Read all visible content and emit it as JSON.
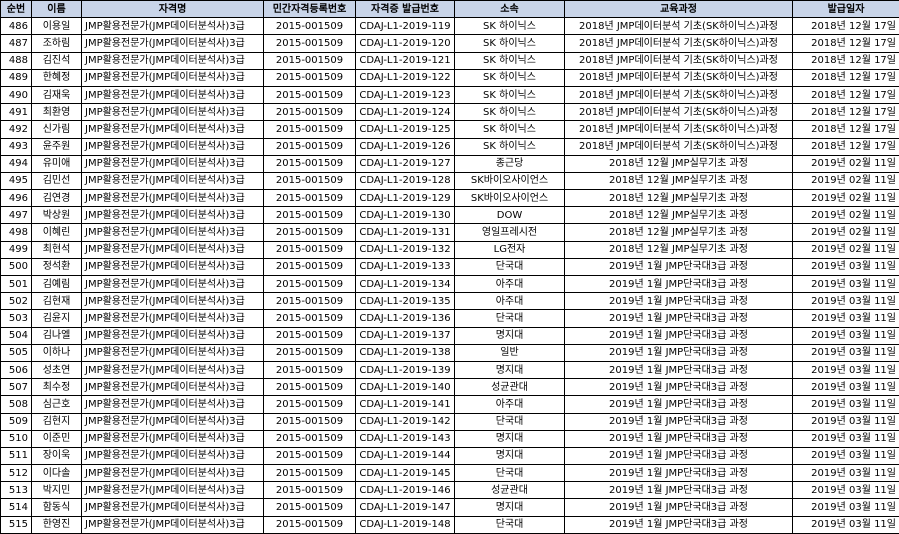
{
  "header": {
    "no": "순번",
    "name": "이름",
    "qual": "자격명",
    "reg": "민간자격등록번호",
    "cert": "자격증 발급번호",
    "org": "소속",
    "course": "교육과정",
    "date": "발급일자"
  },
  "rows": [
    {
      "no": "486",
      "name": "이용일",
      "qual": "JMP활용전문가(JMP데이터분석사)3급",
      "reg": "2015-001509",
      "cert": "CDAJ-L1-2019-119",
      "org": "SK 하이닉스",
      "course": "2018년 JMP데이터분석 기초(SK하이닉스)과정",
      "date": "2018년 12월 17일"
    },
    {
      "no": "487",
      "name": "조하림",
      "qual": "JMP활용전문가(JMP데이터분석사)3급",
      "reg": "2015-001509",
      "cert": "CDAJ-L1-2019-120",
      "org": "SK 하이닉스",
      "course": "2018년 JMP데이터분석 기초(SK하이닉스)과정",
      "date": "2018년 12월 17일"
    },
    {
      "no": "488",
      "name": "김진석",
      "qual": "JMP활용전문가(JMP데이터분석사)3급",
      "reg": "2015-001509",
      "cert": "CDAJ-L1-2019-121",
      "org": "SK 하이닉스",
      "course": "2018년 JMP데이터분석 기초(SK하이닉스)과정",
      "date": "2018년 12월 17일"
    },
    {
      "no": "489",
      "name": "한혜정",
      "qual": "JMP활용전문가(JMP데이터분석사)3급",
      "reg": "2015-001509",
      "cert": "CDAJ-L1-2019-122",
      "org": "SK 하이닉스",
      "course": "2018년 JMP데이터분석 기초(SK하이닉스)과정",
      "date": "2018년 12월 17일"
    },
    {
      "no": "490",
      "name": "김재욱",
      "qual": "JMP활용전문가(JMP데이터분석사)3급",
      "reg": "2015-001509",
      "cert": "CDAJ-L1-2019-123",
      "org": "SK 하이닉스",
      "course": "2018년 JMP데이터분석 기초(SK하이닉스)과정",
      "date": "2018년 12월 17일"
    },
    {
      "no": "491",
      "name": "최환영",
      "qual": "JMP활용전문가(JMP데이터분석사)3급",
      "reg": "2015-001509",
      "cert": "CDAJ-L1-2019-124",
      "org": "SK 하이닉스",
      "course": "2018년 JMP데이터분석 기초(SK하이닉스)과정",
      "date": "2018년 12월 17일"
    },
    {
      "no": "492",
      "name": "신가림",
      "qual": "JMP활용전문가(JMP데이터분석사)3급",
      "reg": "2015-001509",
      "cert": "CDAJ-L1-2019-125",
      "org": "SK 하이닉스",
      "course": "2018년 JMP데이터분석 기초(SK하이닉스)과정",
      "date": "2018년 12월 17일"
    },
    {
      "no": "493",
      "name": "윤주원",
      "qual": "JMP활용전문가(JMP데이터분석사)3급",
      "reg": "2015-001509",
      "cert": "CDAJ-L1-2019-126",
      "org": "SK 하이닉스",
      "course": "2018년 JMP데이터분석 기초(SK하이닉스)과정",
      "date": "2018년 12월 17일"
    },
    {
      "no": "494",
      "name": "유미애",
      "qual": "JMP활용전문가(JMP데이터분석사)3급",
      "reg": "2015-001509",
      "cert": "CDAJ-L1-2019-127",
      "org": "종근당",
      "course": "2018년 12월 JMP실무기초 과정",
      "date": "2019년 02월 11일"
    },
    {
      "no": "495",
      "name": "김민선",
      "qual": "JMP활용전문가(JMP데이터분석사)3급",
      "reg": "2015-001509",
      "cert": "CDAJ-L1-2019-128",
      "org": "SK바이오사이언스",
      "course": "2018년 12월 JMP실무기초 과정",
      "date": "2019년 02월 11일"
    },
    {
      "no": "496",
      "name": "김연경",
      "qual": "JMP활용전문가(JMP데이터분석사)3급",
      "reg": "2015-001509",
      "cert": "CDAJ-L1-2019-129",
      "org": "SK바이오사이언스",
      "course": "2018년 12월 JMP실무기초 과정",
      "date": "2019년 02월 11일"
    },
    {
      "no": "497",
      "name": "박상원",
      "qual": "JMP활용전문가(JMP데이터분석사)3급",
      "reg": "2015-001509",
      "cert": "CDAJ-L1-2019-130",
      "org": "DOW",
      "course": "2018년 12월 JMP실무기초 과정",
      "date": "2019년 02월 11일"
    },
    {
      "no": "498",
      "name": "이혜린",
      "qual": "JMP활용전문가(JMP데이터분석사)3급",
      "reg": "2015-001509",
      "cert": "CDAJ-L1-2019-131",
      "org": "영일프레시전",
      "course": "2018년 12월 JMP실무기초 과정",
      "date": "2019년 02월 11일"
    },
    {
      "no": "499",
      "name": "최현석",
      "qual": "JMP활용전문가(JMP데이터분석사)3급",
      "reg": "2015-001509",
      "cert": "CDAJ-L1-2019-132",
      "org": "LG전자",
      "course": "2018년 12월 JMP실무기초 과정",
      "date": "2019년 02월 11일"
    },
    {
      "no": "500",
      "name": "정석환",
      "qual": "JMP활용전문가(JMP데이터분석사)3급",
      "reg": "2015-001509",
      "cert": "CDAJ-L1-2019-133",
      "org": "단국대",
      "course": "2019년 1월 JMP단국대3급 과정",
      "date": "2019년 03월 11일"
    },
    {
      "no": "501",
      "name": "김예림",
      "qual": "JMP활용전문가(JMP데이터분석사)3급",
      "reg": "2015-001509",
      "cert": "CDAJ-L1-2019-134",
      "org": "아주대",
      "course": "2019년 1월 JMP단국대3급 과정",
      "date": "2019년 03월 11일"
    },
    {
      "no": "502",
      "name": "김현재",
      "qual": "JMP활용전문가(JMP데이터분석사)3급",
      "reg": "2015-001509",
      "cert": "CDAJ-L1-2019-135",
      "org": "아주대",
      "course": "2019년 1월 JMP단국대3급 과정",
      "date": "2019년 03월 11일"
    },
    {
      "no": "503",
      "name": "김윤지",
      "qual": "JMP활용전문가(JMP데이터분석사)3급",
      "reg": "2015-001509",
      "cert": "CDAJ-L1-2019-136",
      "org": "단국대",
      "course": "2019년 1월 JMP단국대3급 과정",
      "date": "2019년 03월 11일"
    },
    {
      "no": "504",
      "name": "김나엘",
      "qual": "JMP활용전문가(JMP데이터분석사)3급",
      "reg": "2015-001509",
      "cert": "CDAJ-L1-2019-137",
      "org": "명지대",
      "course": "2019년 1월 JMP단국대3급 과정",
      "date": "2019년 03월 11일"
    },
    {
      "no": "505",
      "name": "이하나",
      "qual": "JMP활용전문가(JMP데이터분석사)3급",
      "reg": "2015-001509",
      "cert": "CDAJ-L1-2019-138",
      "org": "일반",
      "course": "2019년 1월 JMP단국대3급 과정",
      "date": "2019년 03월 11일"
    },
    {
      "no": "506",
      "name": "성초연",
      "qual": "JMP활용전문가(JMP데이터분석사)3급",
      "reg": "2015-001509",
      "cert": "CDAJ-L1-2019-139",
      "org": "명지대",
      "course": "2019년 1월 JMP단국대3급 과정",
      "date": "2019년 03월 11일"
    },
    {
      "no": "507",
      "name": "최수정",
      "qual": "JMP활용전문가(JMP데이터분석사)3급",
      "reg": "2015-001509",
      "cert": "CDAJ-L1-2019-140",
      "org": "성균관대",
      "course": "2019년 1월 JMP단국대3급 과정",
      "date": "2019년 03월 11일"
    },
    {
      "no": "508",
      "name": "심근호",
      "qual": "JMP활용전문가(JMP데이터분석사)3급",
      "reg": "2015-001509",
      "cert": "CDAJ-L1-2019-141",
      "org": "아주대",
      "course": "2019년 1월 JMP단국대3급 과정",
      "date": "2019년 03월 11일"
    },
    {
      "no": "509",
      "name": "김현지",
      "qual": "JMP활용전문가(JMP데이터분석사)3급",
      "reg": "2015-001509",
      "cert": "CDAJ-L1-2019-142",
      "org": "단국대",
      "course": "2019년 1월 JMP단국대3급 과정",
      "date": "2019년 03월 11일"
    },
    {
      "no": "510",
      "name": "이준민",
      "qual": "JMP활용전문가(JMP데이터분석사)3급",
      "reg": "2015-001509",
      "cert": "CDAJ-L1-2019-143",
      "org": "명지대",
      "course": "2019년 1월 JMP단국대3급 과정",
      "date": "2019년 03월 11일"
    },
    {
      "no": "511",
      "name": "장이욱",
      "qual": "JMP활용전문가(JMP데이터분석사)3급",
      "reg": "2015-001509",
      "cert": "CDAJ-L1-2019-144",
      "org": "명지대",
      "course": "2019년 1월 JMP단국대3급 과정",
      "date": "2019년 03월 11일"
    },
    {
      "no": "512",
      "name": "이다솔",
      "qual": "JMP활용전문가(JMP데이터분석사)3급",
      "reg": "2015-001509",
      "cert": "CDAJ-L1-2019-145",
      "org": "단국대",
      "course": "2019년 1월 JMP단국대3급 과정",
      "date": "2019년 03월 11일"
    },
    {
      "no": "513",
      "name": "박지민",
      "qual": "JMP활용전문가(JMP데이터분석사)3급",
      "reg": "2015-001509",
      "cert": "CDAJ-L1-2019-146",
      "org": "성균관대",
      "course": "2019년 1월 JMP단국대3급 과정",
      "date": "2019년 03월 11일"
    },
    {
      "no": "514",
      "name": "함동식",
      "qual": "JMP활용전문가(JMP데이터분석사)3급",
      "reg": "2015-001509",
      "cert": "CDAJ-L1-2019-147",
      "org": "명지대",
      "course": "2019년 1월 JMP단국대3급 과정",
      "date": "2019년 03월 11일"
    },
    {
      "no": "515",
      "name": "한영진",
      "qual": "JMP활용전문가(JMP데이터분석사)3급",
      "reg": "2015-001509",
      "cert": "CDAJ-L1-2019-148",
      "org": "단국대",
      "course": "2019년 1월 JMP단국대3급 과정",
      "date": "2019년 03월 11일"
    }
  ]
}
